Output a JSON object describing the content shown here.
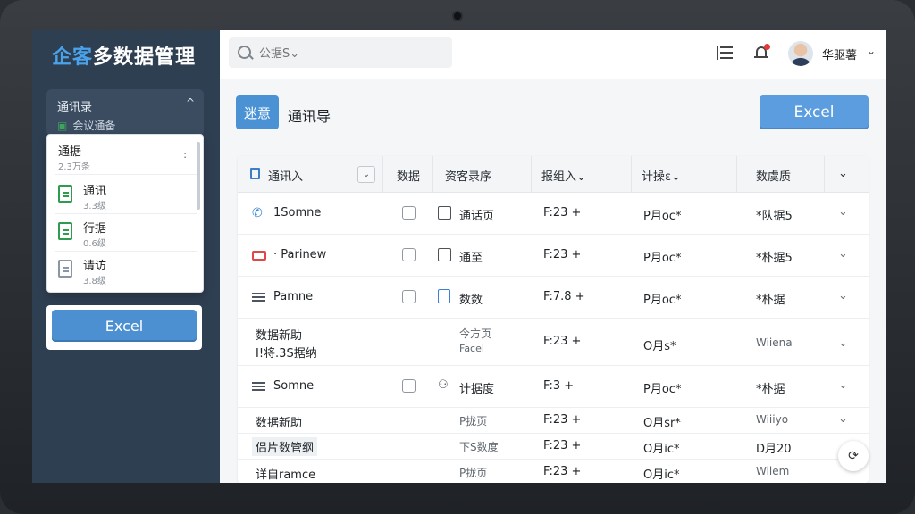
{
  "brand": {
    "accent": "企客",
    "rest": "多数据管理"
  },
  "sidebar": {
    "panel_title": "通讯录",
    "panel_chevron": "^",
    "panel_sub": "会议通备",
    "dropdown": {
      "header": {
        "name": "通据",
        "meta": "2.3万条",
        "more": ":"
      },
      "items": [
        {
          "name": "通讯",
          "meta": "3.3级",
          "icon": "spreadsheet-icon"
        },
        {
          "name": "行据",
          "meta": "0.6级",
          "icon": "spreadsheet-icon"
        },
        {
          "name": "请访",
          "meta": "3.8级",
          "icon": "document-icon"
        }
      ]
    },
    "excel_button": "Excel"
  },
  "topbar": {
    "search_placeholder": "公据S⌄",
    "user_name": "华驱薯",
    "user_chevron": "⌄",
    "icons": [
      "list-icon",
      "bell-icon",
      "avatar"
    ]
  },
  "main": {
    "pill": "迷意",
    "title": "通讯导",
    "excel_button": "Excel"
  },
  "table": {
    "headers": [
      "通讯入",
      "数据",
      "资客录序",
      "报组入⌄",
      "计操ε⌄",
      "数虞质"
    ],
    "header_toggle": "⌄",
    "rows": [
      {
        "icon": "phone-icon",
        "name": "1Somne",
        "name2": "",
        "type": "通话页",
        "col4": "F:23 +",
        "col5": "P月oc*",
        "col6": "*队据5",
        "chevron": "⌄"
      },
      {
        "icon": "mail-icon",
        "name": "· Parinew",
        "name2": "",
        "type": "通至",
        "col4": "F:23 +",
        "col5": "P月oc*",
        "col6": "*朴据5",
        "chevron": "⌄"
      },
      {
        "icon": "list-icon",
        "name": "Pamne",
        "name2": "",
        "type": "数数",
        "col4": "F:7.8 +",
        "col5": "P月oc*",
        "col6": "*朴据",
        "chevron": "⌄"
      },
      {
        "icon": "",
        "name": "数据新助",
        "name2": "I!将.3S据纳",
        "type": "今方页",
        "type2": "Facel",
        "col4": "F:23 +",
        "col5": "O月s*",
        "col6": "Wiiena",
        "chevron": "⌄"
      },
      {
        "icon": "list-icon",
        "name": "Somne",
        "name2": "",
        "type": "计据度",
        "col4": "F:3 +",
        "col5": "P月oc*",
        "col6": "*朴据",
        "chevron": "⌄"
      },
      {
        "icon": "",
        "name": "数据新助",
        "name2": "",
        "type": "P拢页",
        "col4": "F:23 +",
        "col5": "O月sr*",
        "col6": "Wiiiyo",
        "chevron": "⌄"
      },
      {
        "icon": "",
        "name": "侣片数管纲",
        "name2": "",
        "type": "下S数度",
        "col4": "F:23 +",
        "col5": "O月ic*",
        "col6": "D月20",
        "chevron": "⌄"
      },
      {
        "icon": "",
        "name": "详自ramce",
        "name2": "",
        "type": "P拢页",
        "col4": "F:23 +",
        "col5": "O月ic*",
        "col6": "Wilem",
        "chevron": "⌄"
      }
    ]
  },
  "fab": "⟳",
  "colors": {
    "sidebar": "#2f3f52",
    "accent": "#4aa3ea",
    "button": "#5b9ddf",
    "icon_green": "#2e9b4e",
    "icon_red": "#e04848"
  }
}
